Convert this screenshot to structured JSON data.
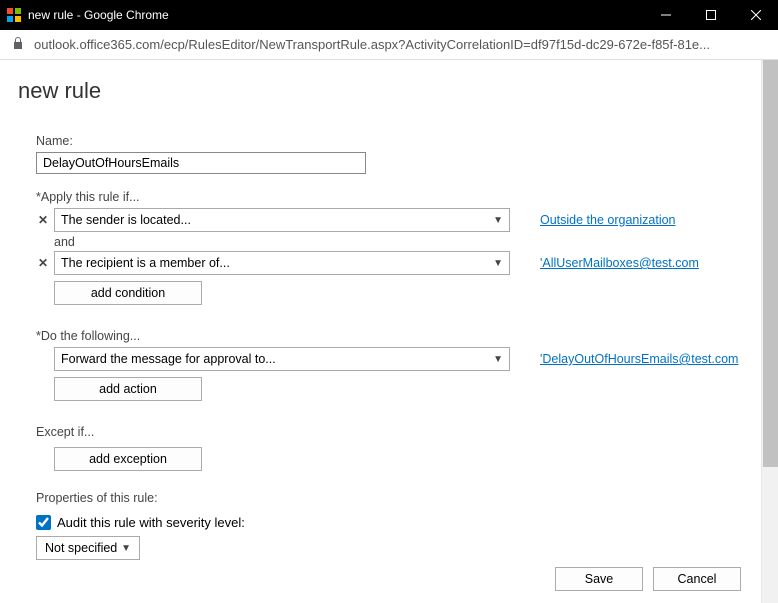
{
  "window": {
    "title": "new rule - Google Chrome"
  },
  "address": {
    "url": "outlook.office365.com/ecp/RulesEditor/NewTransportRule.aspx?ActivityCorrelationID=df97f15d-dc29-672e-f85f-81e..."
  },
  "page": {
    "title": "new rule"
  },
  "form": {
    "name_label": "Name:",
    "name_value": "DelayOutOfHoursEmails",
    "apply_label": "*Apply this rule if...",
    "conditions": [
      {
        "text": "The sender is located...",
        "link": "Outside the organization"
      },
      {
        "text": "The recipient is a member of...",
        "link": "'AllUserMailboxes@test.com"
      }
    ],
    "and_label": "and",
    "add_condition_label": "add condition",
    "do_label": "*Do the following...",
    "actions": [
      {
        "text": "Forward the message for approval to...",
        "link": "'DelayOutOfHoursEmails@test.com"
      }
    ],
    "add_action_label": "add action",
    "except_label": "Except if...",
    "add_exception_label": "add exception",
    "properties_label": "Properties of this rule:",
    "audit_label": "Audit this rule with severity level:",
    "severity_value": "Not specified"
  },
  "footer": {
    "save_label": "Save",
    "cancel_label": "Cancel"
  }
}
